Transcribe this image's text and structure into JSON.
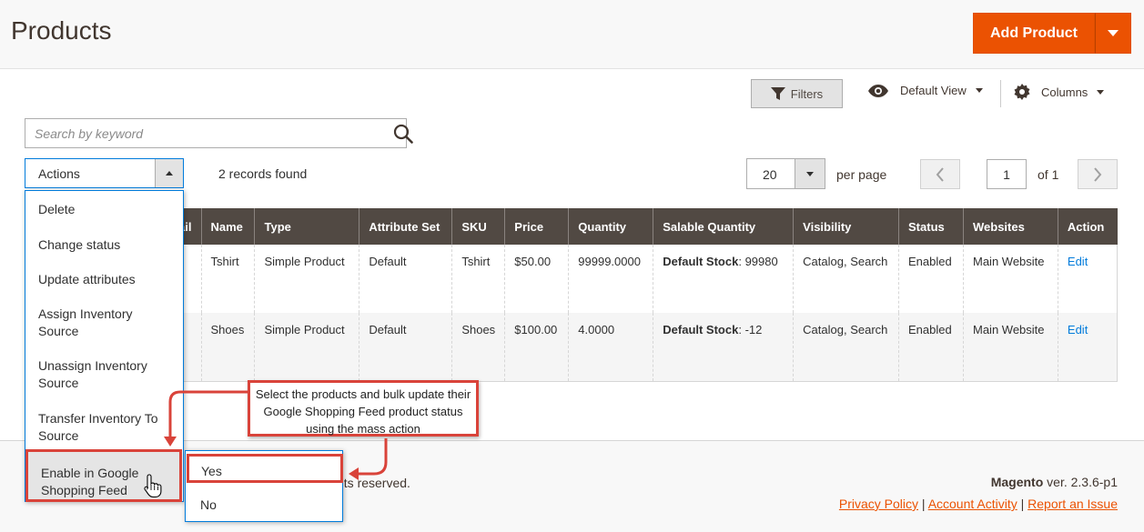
{
  "header": {
    "title": "Products",
    "add_button": "Add Product"
  },
  "toolbar": {
    "filters": "Filters",
    "view": "Default View",
    "columns": "Columns"
  },
  "search": {
    "placeholder": "Search by keyword"
  },
  "actions": {
    "label": "Actions",
    "records": "2 records found",
    "menu": [
      "Delete",
      "Change status",
      "Update attributes",
      "Assign Inventory Source",
      "Unassign Inventory Source",
      "Transfer Inventory To Source",
      "Enable in Google Shopping Feed"
    ],
    "submenu": [
      "Yes",
      "No"
    ]
  },
  "pagination": {
    "per_page_value": "20",
    "per_page_label": "per page",
    "page": "1",
    "of": "of 1"
  },
  "grid": {
    "columns": [
      "ail",
      "Name",
      "Type",
      "Attribute Set",
      "SKU",
      "Price",
      "Quantity",
      "Salable Quantity",
      "Visibility",
      "Status",
      "Websites",
      "Action"
    ],
    "rows": [
      {
        "name": "Tshirt",
        "type": "Simple Product",
        "attribute_set": "Default",
        "sku": "Tshirt",
        "price": "$50.00",
        "quantity": "99999.0000",
        "salable_label": "Default Stock",
        "salable_value": ": 99980",
        "visibility": "Catalog, Search",
        "status": "Enabled",
        "websites": "Main Website",
        "action": "Edit"
      },
      {
        "name": "Shoes",
        "type": "Simple Product",
        "attribute_set": "Default",
        "sku": "Shoes",
        "price": "$100.00",
        "quantity": "4.0000",
        "salable_label": "Default Stock",
        "salable_value": ": -12",
        "visibility": "Catalog, Search",
        "status": "Enabled",
        "websites": "Main Website",
        "action": "Edit"
      }
    ]
  },
  "callout": {
    "text": "Select the products and bulk update their Google Shopping Feed product status using the mass action"
  },
  "footer": {
    "copyright": "nts reserved.",
    "brand": "Magento",
    "version": " ver. 2.3.6-p1",
    "links": [
      "Privacy Policy",
      " Account Activity",
      "Report an Issue"
    ],
    "separator": "|"
  },
  "colors": {
    "accent": "#eb5202",
    "header_dark": "#514943",
    "focus_blue": "#007bdb",
    "annotation_red": "#d9433a"
  }
}
